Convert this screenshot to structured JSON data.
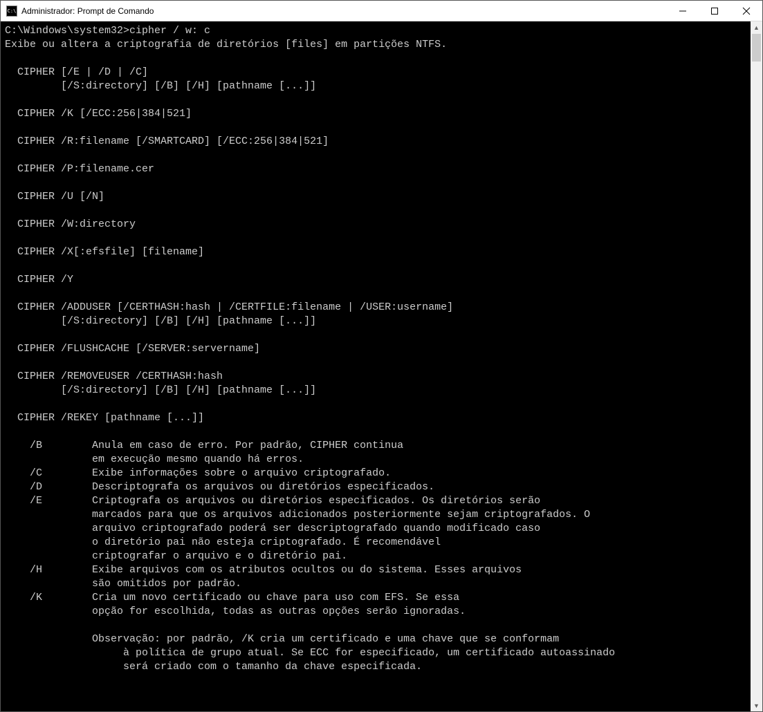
{
  "window": {
    "title": "Administrador: Prompt de Comando",
    "icon_glyph": "C:\\"
  },
  "terminal": {
    "prompt": "C:\\Windows\\system32>",
    "command": "cipher / w: c",
    "lines": [
      "Exibe ou altera a criptografia de diretórios [files] em partições NTFS.",
      "",
      "  CIPHER [/E | /D | /C]",
      "         [/S:directory] [/B] [/H] [pathname [...]]",
      "",
      "  CIPHER /K [/ECC:256|384|521]",
      "",
      "  CIPHER /R:filename [/SMARTCARD] [/ECC:256|384|521]",
      "",
      "  CIPHER /P:filename.cer",
      "",
      "  CIPHER /U [/N]",
      "",
      "  CIPHER /W:directory",
      "",
      "  CIPHER /X[:efsfile] [filename]",
      "",
      "  CIPHER /Y",
      "",
      "  CIPHER /ADDUSER [/CERTHASH:hash | /CERTFILE:filename | /USER:username]",
      "         [/S:directory] [/B] [/H] [pathname [...]]",
      "",
      "  CIPHER /FLUSHCACHE [/SERVER:servername]",
      "",
      "  CIPHER /REMOVEUSER /CERTHASH:hash",
      "         [/S:directory] [/B] [/H] [pathname [...]]",
      "",
      "  CIPHER /REKEY [pathname [...]]",
      "",
      "    /B        Anula em caso de erro. Por padrão, CIPHER continua",
      "              em execução mesmo quando há erros.",
      "    /C        Exibe informações sobre o arquivo criptografado.",
      "    /D        Descriptografa os arquivos ou diretórios especificados.",
      "    /E        Criptografa os arquivos ou diretórios especificados. Os diretórios serão",
      "              marcados para que os arquivos adicionados posteriormente sejam criptografados. O",
      "              arquivo criptografado poderá ser descriptografado quando modificado caso",
      "              o diretório pai não esteja criptografado. É recomendável",
      "              criptografar o arquivo e o diretório pai.",
      "    /H        Exibe arquivos com os atributos ocultos ou do sistema. Esses arquivos",
      "              são omitidos por padrão.",
      "    /K        Cria um novo certificado ou chave para uso com EFS. Se essa",
      "              opção for escolhida, todas as outras opções serão ignoradas.",
      "",
      "              Observação: por padrão, /K cria um certificado e uma chave que se conformam",
      "                   à política de grupo atual. Se ECC for especificado, um certificado autoassinado",
      "                   será criado com o tamanho da chave especificada.",
      ""
    ]
  }
}
